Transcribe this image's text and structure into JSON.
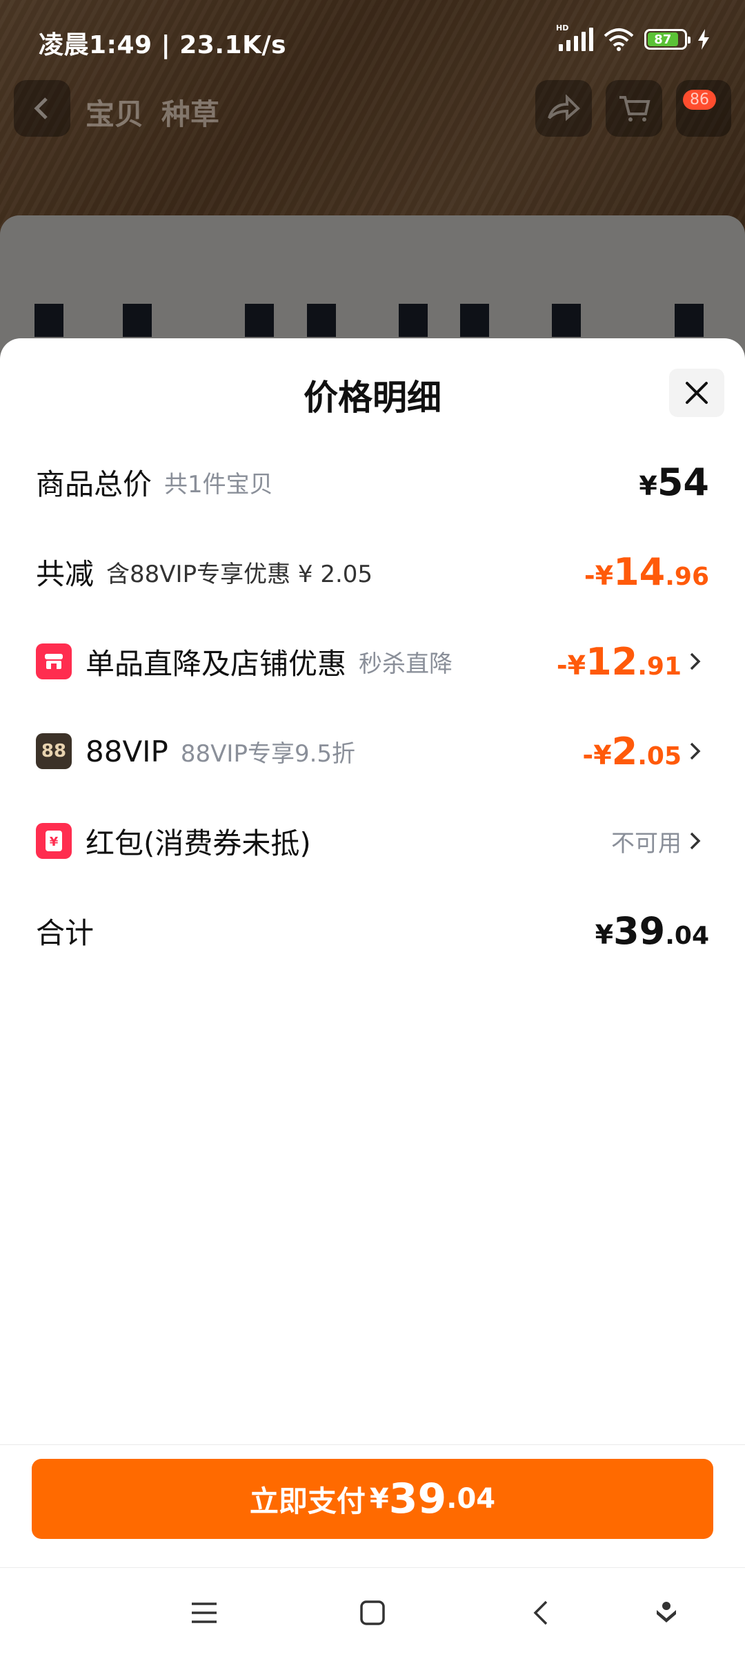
{
  "status_bar": {
    "time": "凌晨1:49 | 23.1K/s",
    "network_label": "HD",
    "battery": "87"
  },
  "background_app": {
    "tabs": [
      "宝贝",
      "种草"
    ],
    "cart_badge": "86"
  },
  "sheet": {
    "title": "价格明细",
    "rows": [
      {
        "label": "商品总价",
        "sub": "共1件宝贝",
        "cur": "¥",
        "int": "54",
        "dec": ""
      },
      {
        "label": "共减",
        "sub": "含88VIP专享优惠 ¥ 2.05",
        "cur": "-¥",
        "int": "14",
        "dec": ".96"
      },
      {
        "label": "单品直降及店铺优惠",
        "sub": "秒杀直降",
        "cur": "-¥",
        "int": "12",
        "dec": ".91",
        "icon": "store-icon"
      },
      {
        "label": "88VIP",
        "sub": "88VIP专享9.5折",
        "cur": "-¥",
        "int": "2",
        "dec": ".05",
        "icon_text": "88"
      },
      {
        "label": "红包(消费券未抵)",
        "value_text": "不可用",
        "icon": "red-packet-icon"
      },
      {
        "label": "合计",
        "cur": "¥",
        "int": "39",
        "dec": ".04"
      }
    ]
  },
  "footer": {
    "pay_label": "立即支付",
    "cur": "¥",
    "int": "39",
    "dec": ".04"
  },
  "colors": {
    "accent": "#ff6a00",
    "discount": "#ff5a0a",
    "icon_red": "#ff2d4f",
    "vip_dark": "#3c3228"
  }
}
